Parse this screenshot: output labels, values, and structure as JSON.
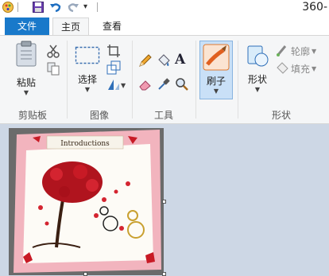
{
  "window": {
    "title": "360-"
  },
  "tabs": [
    {
      "label": "文件"
    },
    {
      "label": "主页"
    },
    {
      "label": "查看"
    }
  ],
  "ribbon": {
    "clipboard": {
      "paste_label": "粘贴",
      "group_label": "剪贴板"
    },
    "image": {
      "select_label": "选择",
      "group_label": "图像"
    },
    "tools": {
      "group_label": "工具"
    },
    "brushes": {
      "label": "刷子"
    },
    "shapes": {
      "shapes_label": "形状",
      "outline_label": "轮廓",
      "fill_label": "填充",
      "group_label": "形状"
    }
  },
  "canvas": {
    "image_text": "Introductions"
  },
  "colors": {
    "accent": "#1979ca",
    "ribbon_bg": "#f5f6f7",
    "workspace_bg": "#cdd7e5",
    "selected_bg": "#c9e0f7"
  }
}
